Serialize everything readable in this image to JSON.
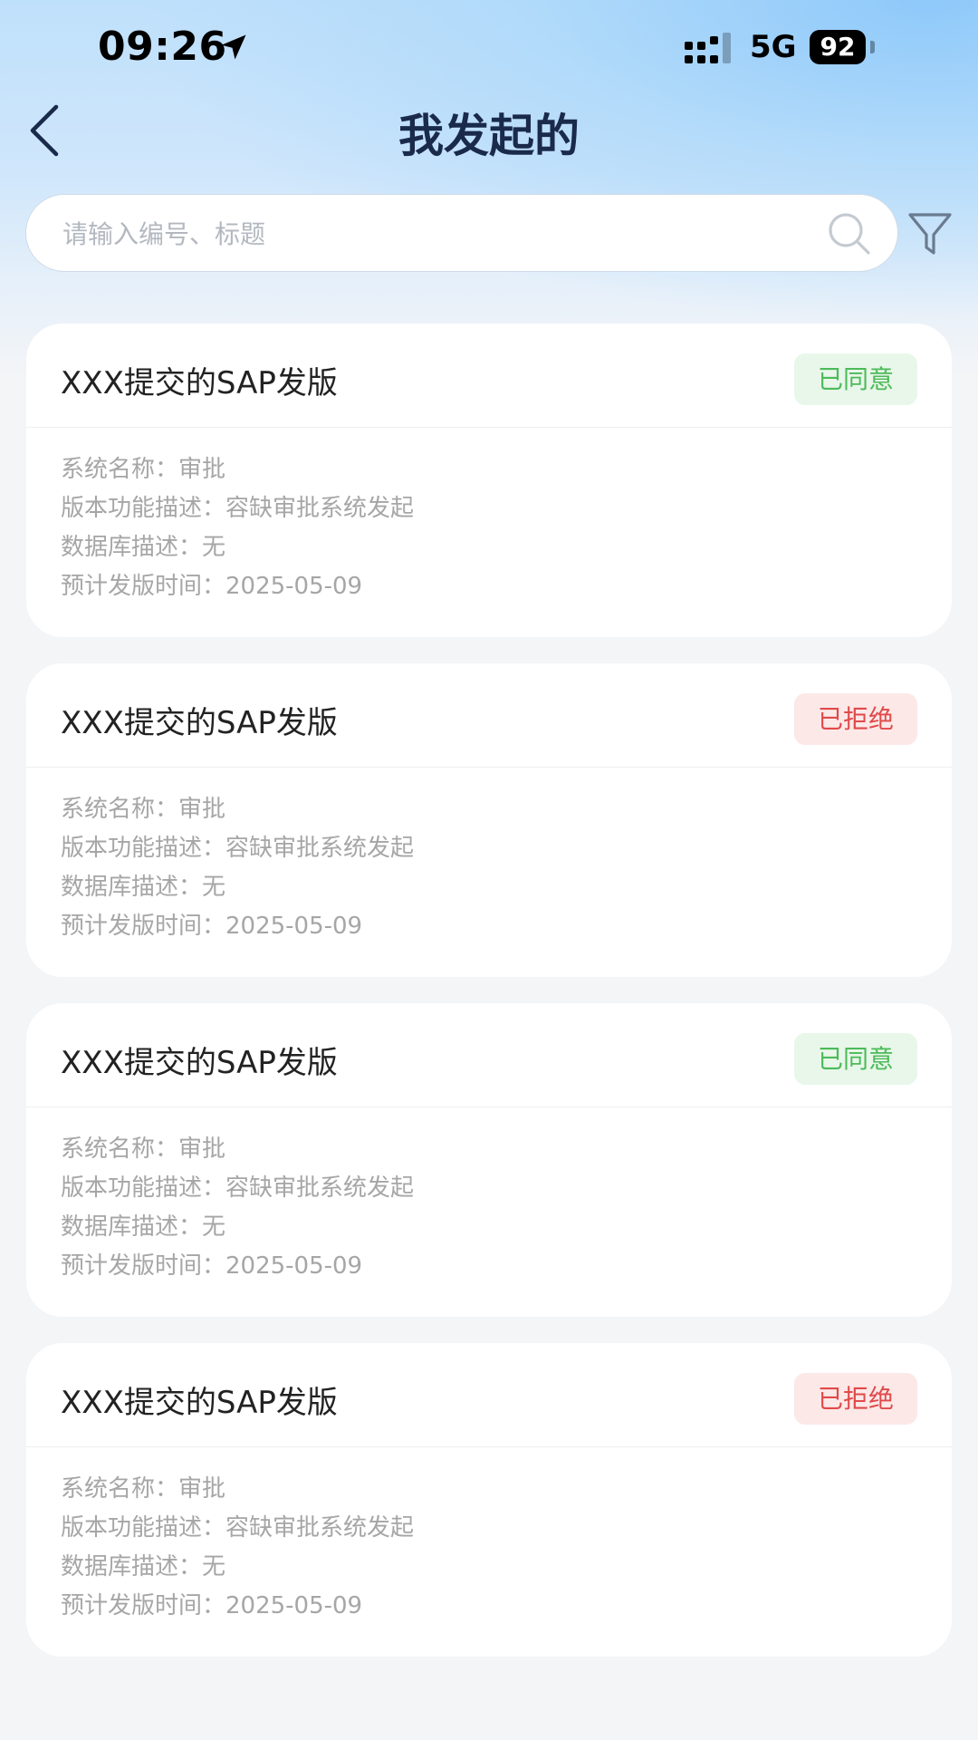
{
  "status_bar": {
    "time": "09:26",
    "network": "5G",
    "battery": "92"
  },
  "nav": {
    "title": "我发起的"
  },
  "search": {
    "placeholder": "请输入编号、标题"
  },
  "icons": {
    "back": "chevron-left-icon",
    "search": "search-icon",
    "filter": "filter-icon",
    "location": "location-arrow-icon"
  },
  "colors": {
    "approved_text": "#4cba59",
    "approved_bg": "#e8f7e9",
    "rejected_text": "#e04a4a",
    "rejected_bg": "#fde8e8",
    "title": "#1a2a4a"
  },
  "cards": [
    {
      "title": "XXX提交的SAP发版",
      "status": "已同意",
      "status_type": "approved",
      "fields": [
        "系统名称：审批",
        "版本功能描述：容缺审批系统发起",
        "数据库描述：无",
        "预计发版时间：2025-05-09"
      ]
    },
    {
      "title": "XXX提交的SAP发版",
      "status": "已拒绝",
      "status_type": "rejected",
      "fields": [
        "系统名称：审批",
        "版本功能描述：容缺审批系统发起",
        "数据库描述：无",
        "预计发版时间：2025-05-09"
      ]
    },
    {
      "title": "XXX提交的SAP发版",
      "status": "已同意",
      "status_type": "approved",
      "fields": [
        "系统名称：审批",
        "版本功能描述：容缺审批系统发起",
        "数据库描述：无",
        "预计发版时间：2025-05-09"
      ]
    },
    {
      "title": "XXX提交的SAP发版",
      "status": "已拒绝",
      "status_type": "rejected",
      "fields": [
        "系统名称：审批",
        "版本功能描述：容缺审批系统发起",
        "数据库描述：无",
        "预计发版时间：2025-05-09"
      ]
    }
  ]
}
